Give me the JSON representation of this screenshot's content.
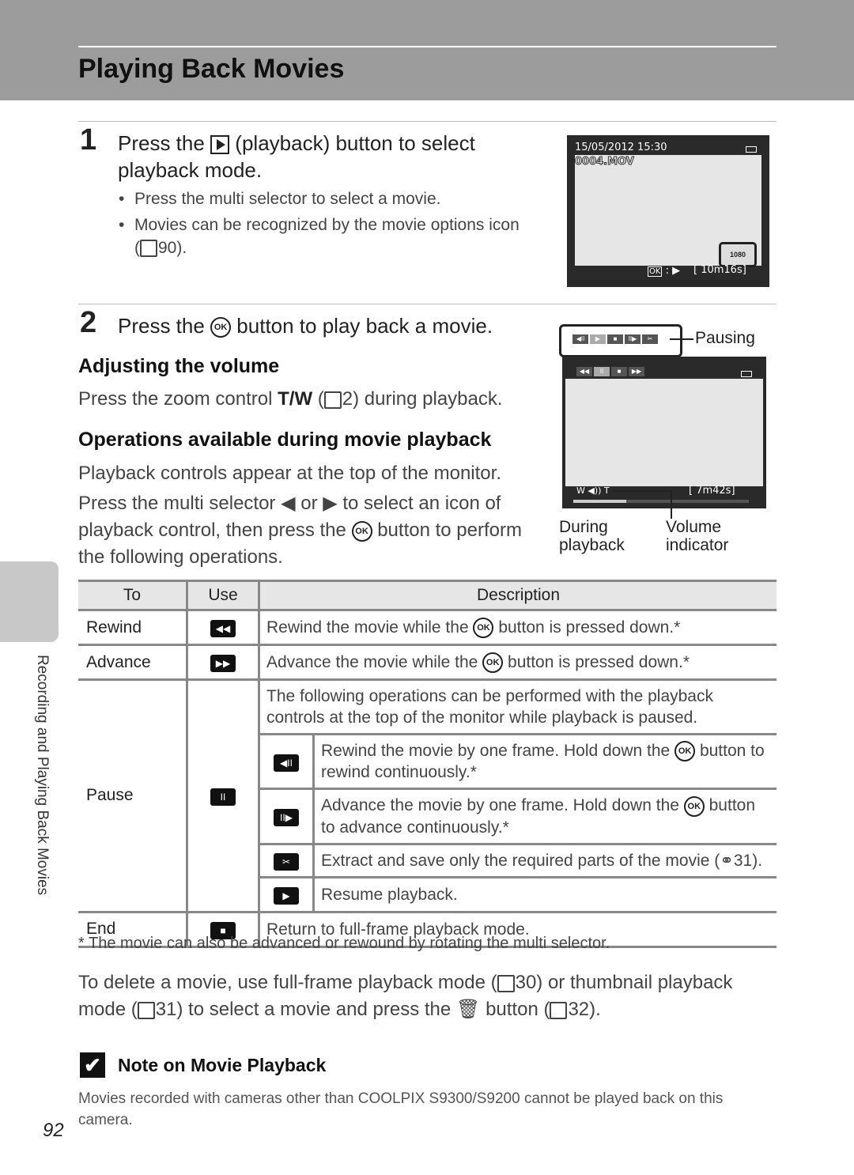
{
  "header": {
    "title": "Playing Back Movies"
  },
  "side_tab": {
    "label": "Recording and Playing Back Movies"
  },
  "step1": {
    "number": "1",
    "text_before": "Press the",
    "text_after": "(playback) button to select playback mode.",
    "bullets": [
      "Press the multi selector to select a movie.",
      "Movies can be recognized by the movie options icon"
    ],
    "ref": "90)."
  },
  "screen1": {
    "datetime": "15/05/2012 15:30",
    "filename": "0004.MOV",
    "ok_label": "OK",
    "duration": "[ 10m16s]",
    "movie_icon": "1080"
  },
  "step2": {
    "number": "2",
    "text_before": "Press the",
    "text_after": "button to play back a movie."
  },
  "ok_glyph": "OK",
  "volume": {
    "heading": "Adjusting the volume",
    "text_before": "Press the zoom control",
    "tw": "T/W",
    "ref": "2) during playback."
  },
  "operations": {
    "heading": "Operations available during movie playback",
    "p1": "Playback controls appear at the top of the monitor.",
    "p2a": "Press the multi selector ◀ or ▶ to select an icon of",
    "p2b_before": "playback control, then press the",
    "p2b_after": "button to perform",
    "p2c": "the following operations."
  },
  "screen2": {
    "pausing_label": "Pausing",
    "pause_controls": [
      "◀II",
      "▶",
      "■",
      "II▶",
      "✂"
    ],
    "play_controls": [
      "◀◀",
      "II",
      "■",
      "▶▶"
    ],
    "duration": "[ 7m42s]",
    "progress": 0.3,
    "label_during": "During playback",
    "label_volume": "Volume indicator"
  },
  "table": {
    "headers": [
      "To",
      "Use",
      "Description"
    ],
    "rows": [
      {
        "to": "Rewind",
        "icon": "◀◀",
        "desc_before": "Rewind the movie while the",
        "desc_after": "button is pressed down.*"
      },
      {
        "to": "Advance",
        "icon": "▶▶",
        "desc_before": "Advance the movie while the",
        "desc_after": "button is pressed down.*"
      }
    ],
    "pause": {
      "to": "Pause",
      "icon": "II",
      "intro": "The following operations can be performed with the playback controls at the top of the monitor while playback is paused.",
      "sub": [
        {
          "icon": "◀II",
          "text_before": "Rewind the movie by one frame. Hold down the",
          "text_after": "button to rewind continuously.*"
        },
        {
          "icon": "II▶",
          "text_before": "Advance the movie by one frame. Hold down the",
          "text_after": "button to advance continuously.*"
        },
        {
          "icon": "✂",
          "text_before": "Extract and save only the required parts of the movie (",
          "text_after": "31)."
        },
        {
          "icon": "▶",
          "text_before": "Resume playback.",
          "text_after": ""
        }
      ]
    },
    "end": {
      "to": "End",
      "icon": "■",
      "desc": "Return to full-frame playback mode."
    }
  },
  "footnote": "*  The movie can also be advanced or rewound by rotating the multi selector.",
  "delete": {
    "line1_before": "To delete a movie, use full-frame playback mode (",
    "line1_ref": "30) or thumbnail playback",
    "line2_before": "mode (",
    "line2_ref": "31) to select a movie and press the",
    "line2_after": "button (",
    "line2_end": "32)."
  },
  "note": {
    "title": "Note on Movie Playback",
    "body": "Movies recorded with cameras other than COOLPIX S9300/S9200 cannot be played back on this camera."
  },
  "page_number": "92"
}
